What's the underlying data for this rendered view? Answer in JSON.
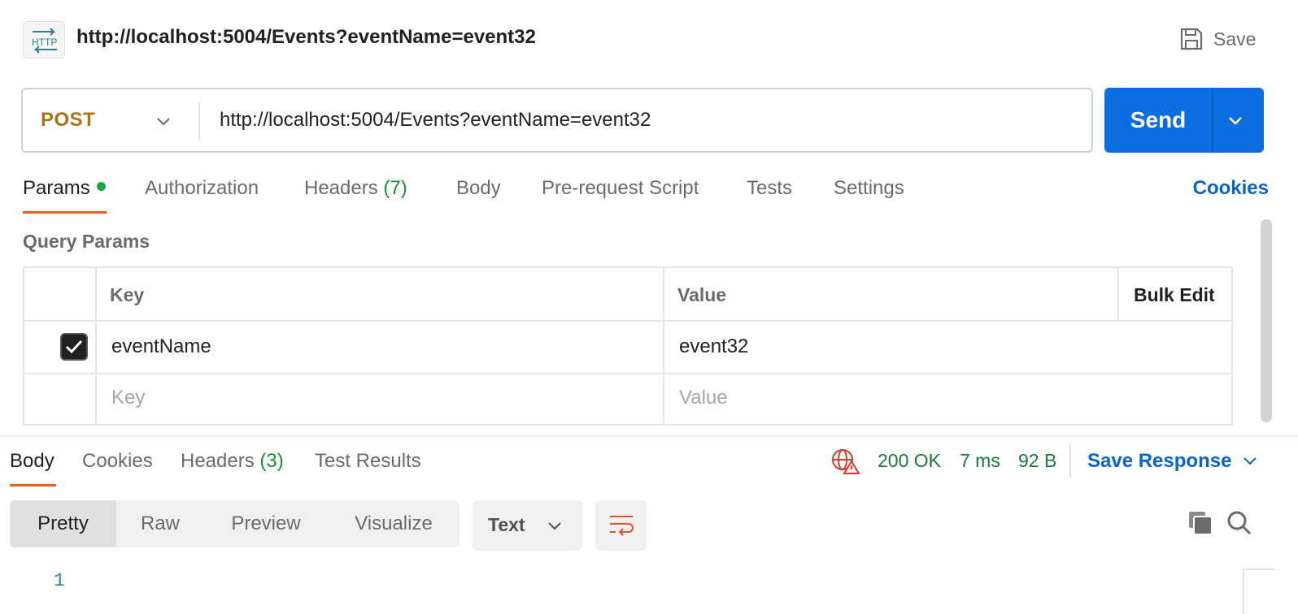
{
  "header": {
    "title": "http://localhost:5004/Events?eventName=event32",
    "http_icon_label": "HTTP",
    "save_label": "Save"
  },
  "request": {
    "method": "POST",
    "url": "http://localhost:5004/Events?eventName=event32",
    "send_label": "Send"
  },
  "tabs": {
    "params": "Params",
    "authorization": "Authorization",
    "headers": "Headers",
    "headers_count": "(7)",
    "body": "Body",
    "prerequest": "Pre-request Script",
    "tests": "Tests",
    "settings": "Settings",
    "cookies": "Cookies"
  },
  "query_params": {
    "title": "Query Params",
    "columns": {
      "key": "Key",
      "value": "Value",
      "bulk_edit": "Bulk Edit"
    },
    "rows": [
      {
        "checked": true,
        "key": "eventName",
        "value": "event32"
      }
    ],
    "new_row": {
      "key_placeholder": "Key",
      "value_placeholder": "Value"
    }
  },
  "response": {
    "tabs": {
      "body": "Body",
      "cookies": "Cookies",
      "headers": "Headers",
      "headers_count": "(3)",
      "test_results": "Test Results"
    },
    "status": "200 OK",
    "time": "7 ms",
    "size": "92 B",
    "save_response": "Save Response",
    "formats": [
      "Pretty",
      "Raw",
      "Preview",
      "Visualize"
    ],
    "language": "Text",
    "line_numbers": [
      "1"
    ]
  },
  "colors": {
    "accent": "#0a6de0",
    "method": "#a8741a",
    "status_ok": "#1a7a3a",
    "tab_underline": "#ef5b25"
  }
}
